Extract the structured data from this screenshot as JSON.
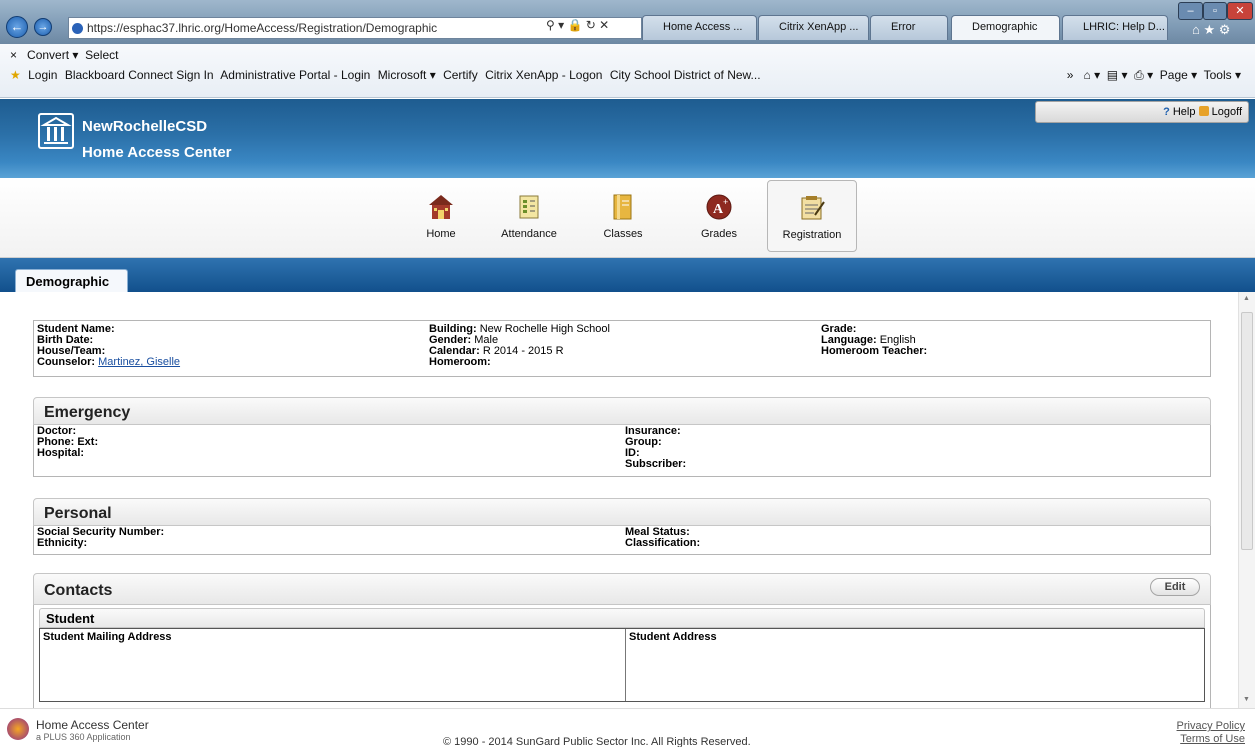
{
  "browser": {
    "url": "https://esphac37.lhric.org/HomeAccess/Registration/Demographic",
    "tabs": [
      "Home Access ...",
      "Citrix XenApp ...",
      "Error",
      "Demographic",
      "LHRIC: Help D..."
    ],
    "convert_label": "Convert",
    "select_label": "Select",
    "favorites": [
      "Login",
      "Blackboard Connect Sign In",
      "Administrative Portal - Login",
      "Microsoft ▾",
      "Certify",
      "Citrix XenApp - Logon",
      "City School District of New..."
    ],
    "page_menu": "Page ▾",
    "tools_menu": "Tools ▾"
  },
  "header": {
    "district": "NewRochelleCSD",
    "app": "Home Access Center",
    "help_label": "Help",
    "logoff_label": "Logoff"
  },
  "nav": [
    {
      "label": "Home",
      "icon": "school-house-icon"
    },
    {
      "label": "Attendance",
      "icon": "calendar-icon"
    },
    {
      "label": "Classes",
      "icon": "notebook-icon"
    },
    {
      "label": "Grades",
      "icon": "a-plus-icon"
    },
    {
      "label": "Registration",
      "icon": "clipboard-icon"
    }
  ],
  "page_tab": "Demographic",
  "student": {
    "col1": [
      {
        "label": "Student Name:",
        "value": ""
      },
      {
        "label": "Birth Date:",
        "value": ""
      },
      {
        "label": "House/Team:",
        "value": ""
      },
      {
        "label": "Counselor:",
        "value": "Martinez, Giselle"
      }
    ],
    "col2": [
      {
        "label": "Building:",
        "value": "New Rochelle High School"
      },
      {
        "label": "Gender:",
        "value": "Male"
      },
      {
        "label": "Calendar:",
        "value": "R 2014 - 2015 R"
      },
      {
        "label": "Homeroom:",
        "value": ""
      }
    ],
    "col3": [
      {
        "label": "Grade:",
        "value": ""
      },
      {
        "label": "Language:",
        "value": "English"
      },
      {
        "label": "Homeroom Teacher:",
        "value": ""
      }
    ]
  },
  "emergency": {
    "title": "Emergency",
    "left": [
      "Doctor:",
      "Phone: Ext:",
      "Hospital:"
    ],
    "right": [
      "Insurance:",
      "Group:",
      "ID:",
      "Subscriber:"
    ]
  },
  "personal": {
    "title": "Personal",
    "left": [
      "Social Security Number:",
      "Ethnicity:"
    ],
    "right": [
      "Meal Status:",
      "Classification:"
    ]
  },
  "contacts": {
    "title": "Contacts",
    "edit_label": "Edit",
    "sub_title": "Student",
    "col_left": "Student Mailing Address",
    "col_right": "Student Address"
  },
  "footer": {
    "app": "Home Access Center",
    "sub": "a PLUS 360 Application",
    "copyright": "© 1990 - 2014 SunGard Public Sector Inc. All Rights Reserved.",
    "privacy": "Privacy Policy",
    "terms": "Terms of Use"
  }
}
